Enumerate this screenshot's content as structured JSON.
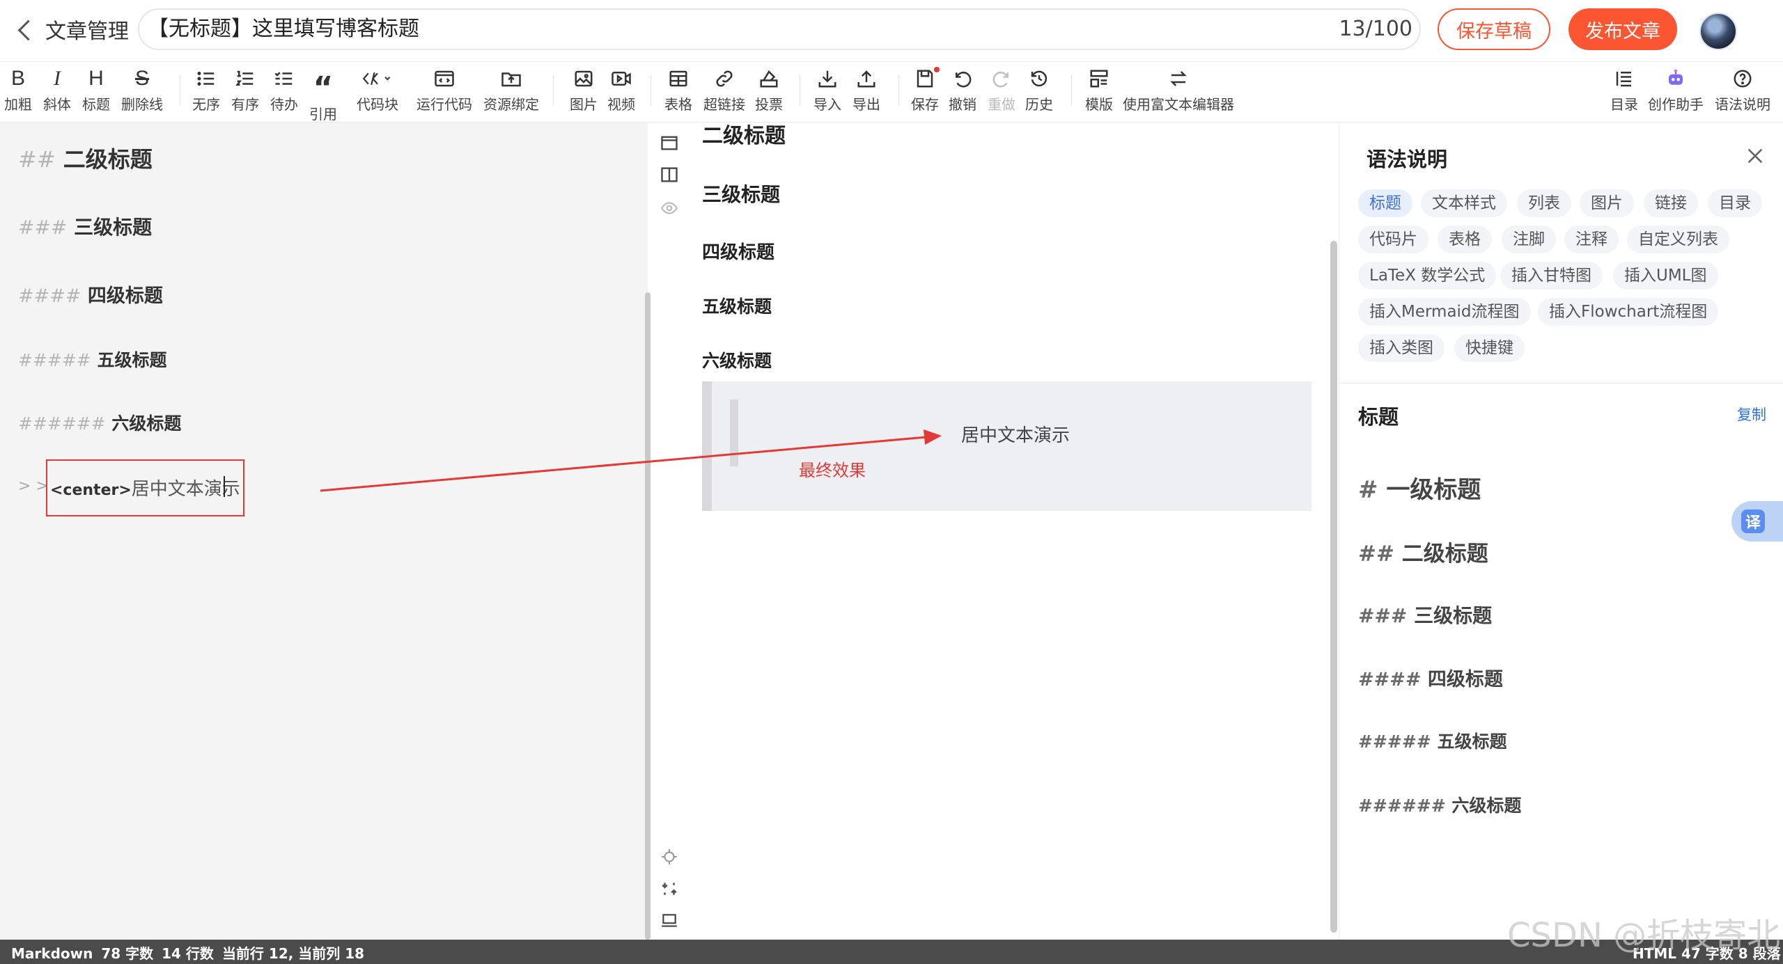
{
  "header": {
    "back_label": "文章管理",
    "title_value": "【无标题】这里填写博客标题",
    "title_count": "13/100",
    "save_draft_label": "保存草稿",
    "publish_label": "发布文章"
  },
  "toolbar": {
    "bold": {
      "icon": "B",
      "label": "加粗"
    },
    "italic": {
      "icon": "I",
      "label": "斜体"
    },
    "heading": {
      "icon": "H",
      "label": "标题"
    },
    "strike": {
      "icon": "S",
      "label": "删除线"
    },
    "ul": {
      "label": "无序"
    },
    "ol": {
      "label": "有序"
    },
    "todo": {
      "label": "待办"
    },
    "quote": {
      "icon": "“",
      "label": "引用"
    },
    "code": {
      "label": "代码块"
    },
    "run": {
      "label": "运行代码"
    },
    "resource": {
      "label": "资源绑定"
    },
    "image": {
      "label": "图片"
    },
    "video": {
      "label": "视频"
    },
    "table": {
      "label": "表格"
    },
    "link": {
      "label": "超链接"
    },
    "vote": {
      "label": "投票"
    },
    "import": {
      "label": "导入"
    },
    "export": {
      "label": "导出"
    },
    "save": {
      "label": "保存"
    },
    "undo": {
      "label": "撤销"
    },
    "redo": {
      "label": "重做"
    },
    "history": {
      "label": "历史"
    },
    "template": {
      "label": "模版"
    },
    "richtext": {
      "label": "使用富文本编辑器"
    },
    "toc": {
      "label": "目录"
    },
    "assistant": {
      "label": "创作助手"
    },
    "syntax": {
      "label": "语法说明"
    }
  },
  "editor": {
    "lines": [
      {
        "hash": "##",
        "text": "二级标题"
      },
      {
        "hash": "###",
        "text": "三级标题"
      },
      {
        "hash": "####",
        "text": "四级标题"
      },
      {
        "hash": "#####",
        "text": "五级标题"
      },
      {
        "hash": "######",
        "text": "六级标题"
      }
    ],
    "quote_prefix": "> >",
    "center_tag": "<center>",
    "center_text": "居中文本演示"
  },
  "preview": {
    "headings": [
      "二级标题",
      "三级标题",
      "四级标题",
      "五级标题",
      "六级标题"
    ],
    "center_text": "居中文本演示",
    "annotation": "最终效果"
  },
  "syntax_panel": {
    "title": "语法说明",
    "chips": [
      "标题",
      "文本样式",
      "列表",
      "图片",
      "链接",
      "目录",
      "代码片",
      "表格",
      "注脚",
      "注释",
      "自定义列表",
      "LaTeX 数学公式",
      "插入甘特图",
      "插入UML图",
      "插入Mermaid流程图",
      "插入Flowchart流程图",
      "插入类图",
      "快捷键"
    ],
    "section_title": "标题",
    "copy_label": "复制",
    "examples": [
      {
        "hash": "#",
        "text": "一级标题"
      },
      {
        "hash": "##",
        "text": "二级标题"
      },
      {
        "hash": "###",
        "text": "三级标题"
      },
      {
        "hash": "####",
        "text": "四级标题"
      },
      {
        "hash": "#####",
        "text": "五级标题"
      },
      {
        "hash": "######",
        "text": "六级标题"
      }
    ],
    "translate_label": "译"
  },
  "status": {
    "mode": "Markdown",
    "chars": "78 字数",
    "lines": "14 行数",
    "cursor": "当前行 12, 当前列 18",
    "right": "HTML  47 字数  8 段落"
  },
  "watermark": "CSDN @折枝寄北",
  "colors": {
    "accent": "#fc5531",
    "arrow": "#e53935",
    "link": "#2e6ef2"
  }
}
